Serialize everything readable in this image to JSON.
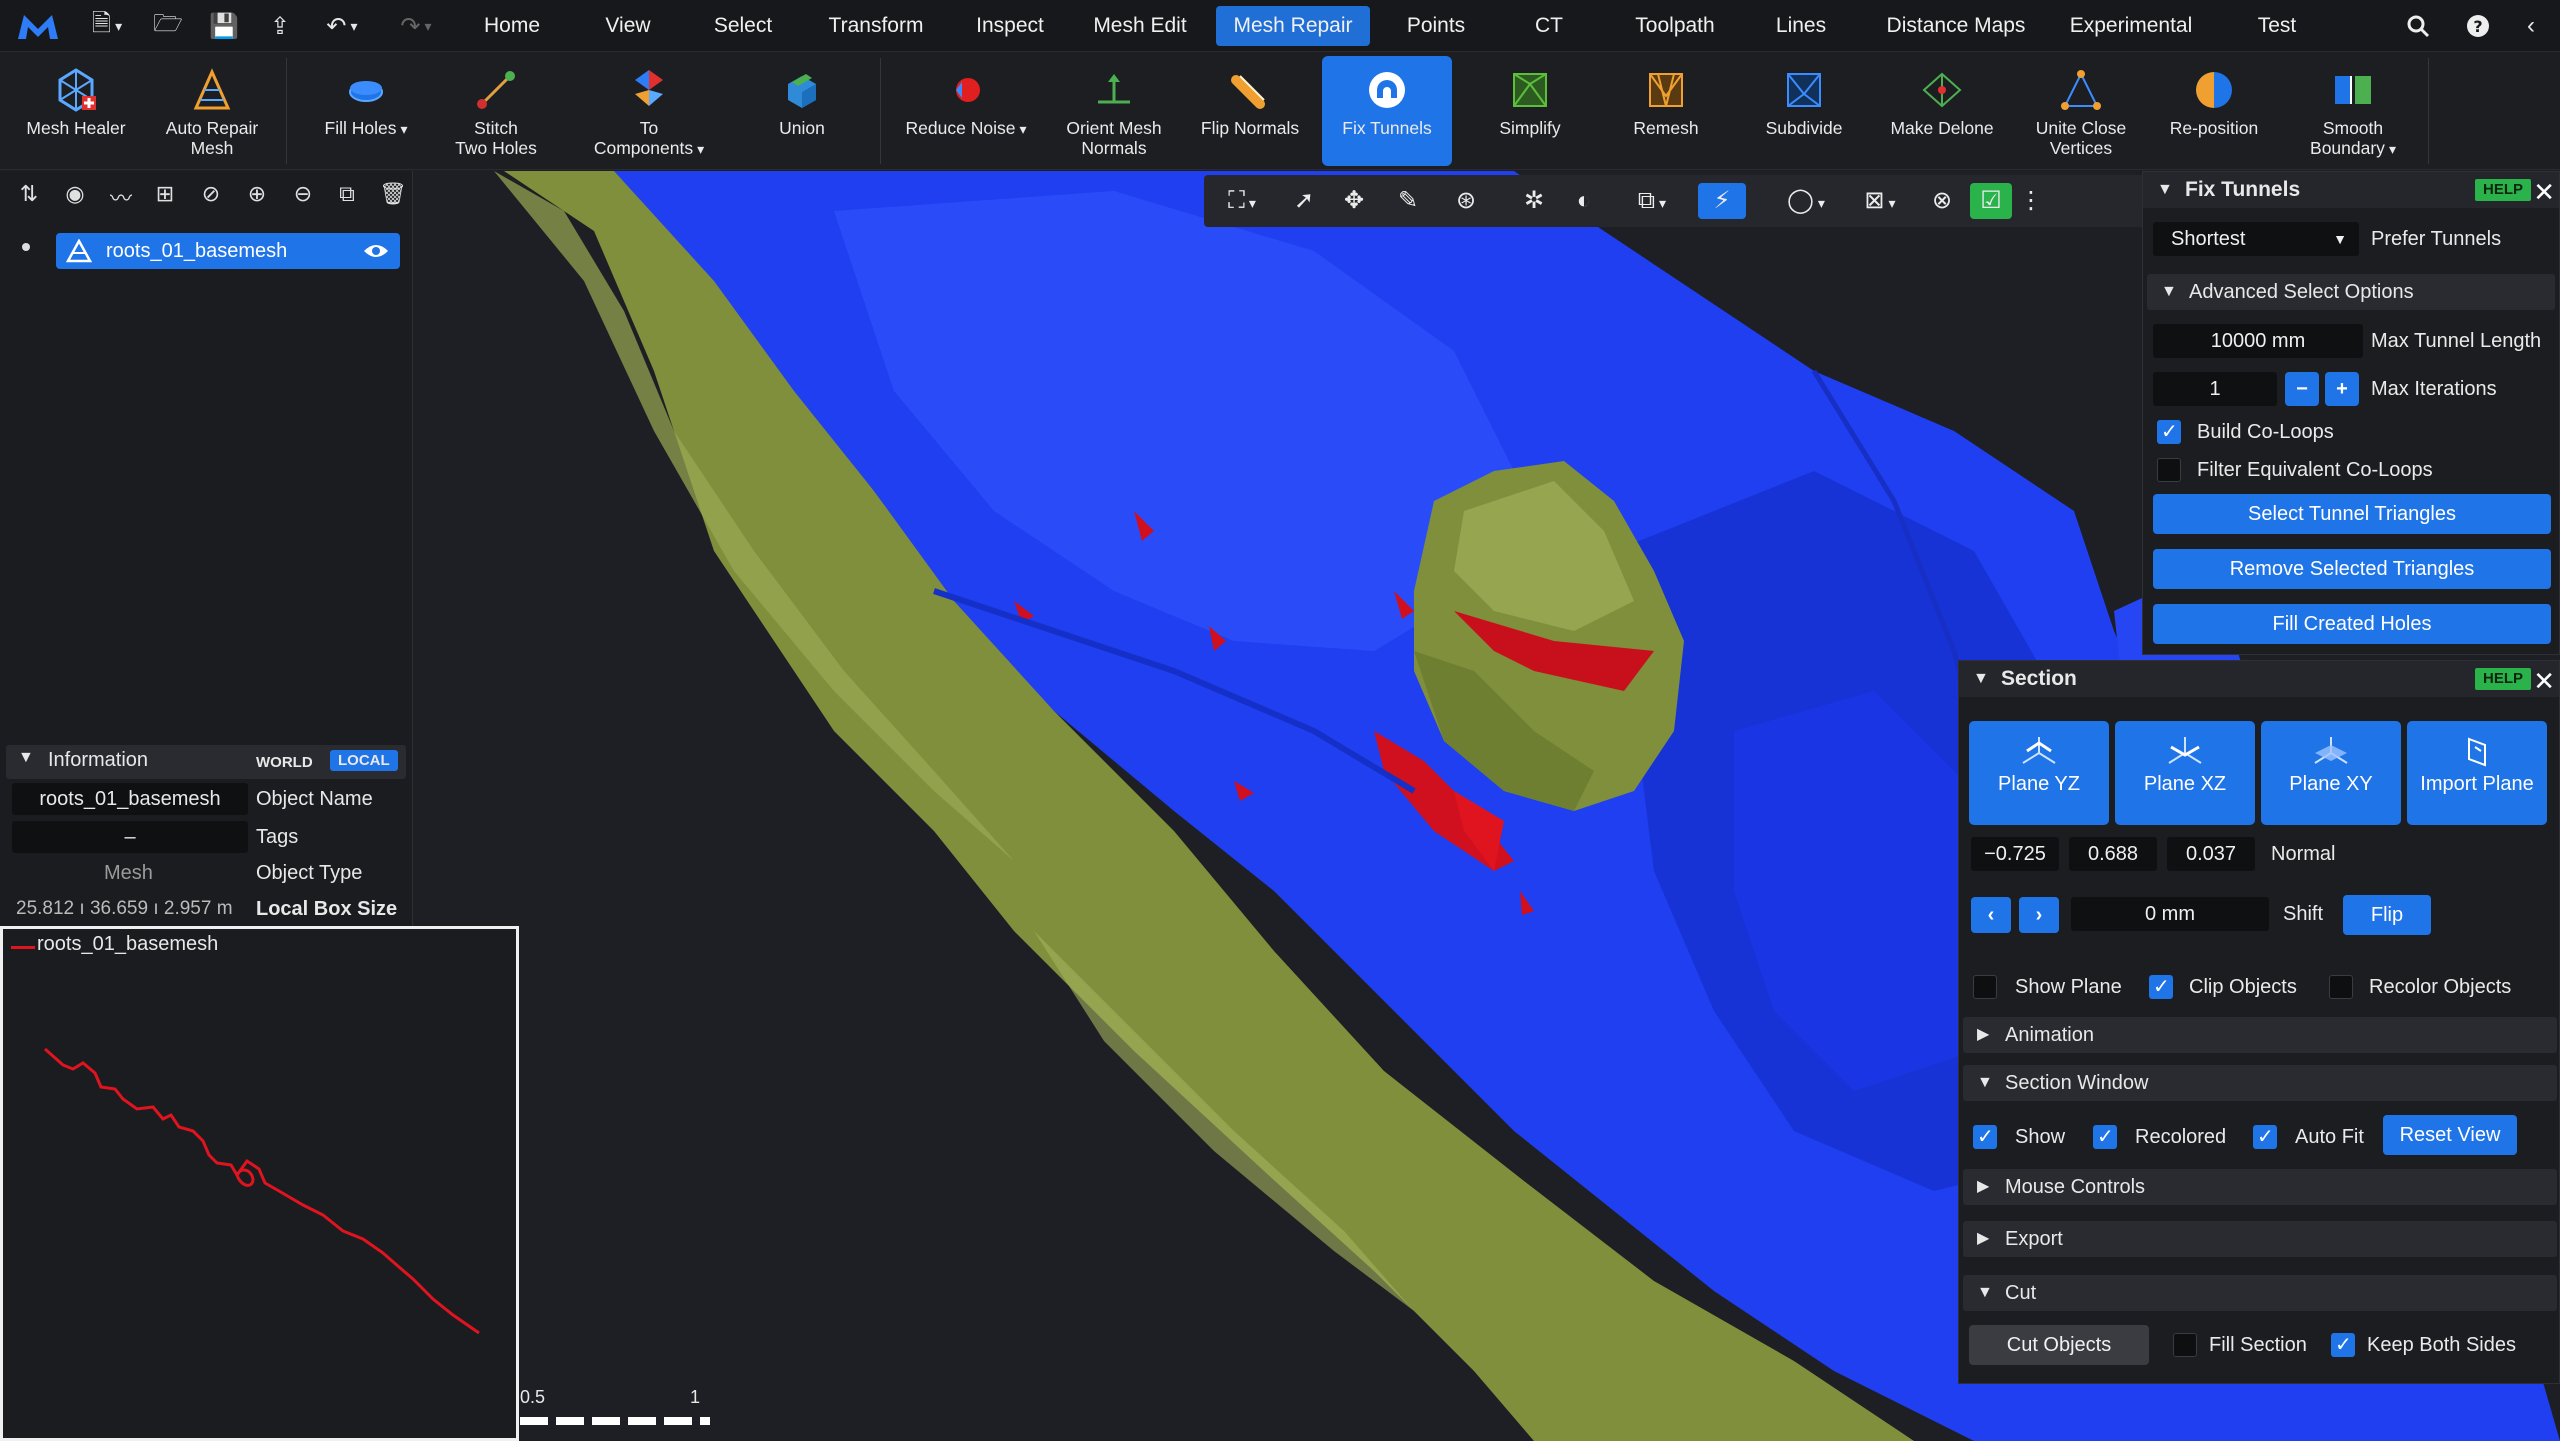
{
  "menubar": {
    "tabs": [
      "Home",
      "View",
      "Select",
      "Transform",
      "Inspect",
      "Mesh Edit",
      "Mesh Repair",
      "Points",
      "CT",
      "Toolpath",
      "Lines",
      "Distance Maps",
      "Experimental",
      "Test"
    ],
    "active_tab": "Mesh Repair"
  },
  "ribbon": {
    "tools": [
      {
        "label": "Mesh Healer",
        "icon": "mesh-healer-icon"
      },
      {
        "label": "Auto Repair\nMesh",
        "icon": "auto-repair-icon"
      },
      {
        "label": "Fill Holes",
        "icon": "fill-holes-icon"
      },
      {
        "label": "Stitch\nTwo Holes",
        "icon": "stitch-icon"
      },
      {
        "label": "To\nComponents",
        "icon": "components-icon"
      },
      {
        "label": "Union",
        "icon": "union-icon"
      },
      {
        "label": "Reduce Noise",
        "icon": "reduce-noise-icon"
      },
      {
        "label": "Orient Mesh\nNormals",
        "icon": "orient-normals-icon"
      },
      {
        "label": "Flip Normals",
        "icon": "flip-normals-icon"
      },
      {
        "label": "Fix Tunnels",
        "icon": "fix-tunnels-icon"
      },
      {
        "label": "Simplify",
        "icon": "simplify-icon"
      },
      {
        "label": "Remesh",
        "icon": "remesh-icon"
      },
      {
        "label": "Subdivide",
        "icon": "subdivide-icon"
      },
      {
        "label": "Make Delone",
        "icon": "delone-icon"
      },
      {
        "label": "Unite Close\nVertices",
        "icon": "unite-vertices-icon"
      },
      {
        "label": "Re-position",
        "icon": "reposition-icon"
      },
      {
        "label": "Smooth\nBoundary",
        "icon": "smooth-boundary-icon"
      }
    ]
  },
  "scene": {
    "object_name": "roots_01_basemesh"
  },
  "information": {
    "title": "Information",
    "world": "WORLD",
    "local": "LOCAL",
    "object_name_value": "roots_01_basemesh",
    "object_name_label": "Object Name",
    "tags_value": "–",
    "tags_label": "Tags",
    "type_value": "Mesh",
    "type_label": "Object Type",
    "box_value": "25.812 ı 36.659 ı 2.957 m",
    "box_label": "Local Box Size"
  },
  "section_window": {
    "legend": "roots_01_basemesh",
    "scale_labels": [
      "0.5",
      "1"
    ]
  },
  "fix_tunnels": {
    "title": "Fix Tunnels",
    "help": "HELP",
    "mode_value": "Shortest",
    "mode_label": "Prefer Tunnels",
    "advanced_title": "Advanced Select Options",
    "max_length_value": "10000 mm",
    "max_length_label": "Max Tunnel Length",
    "iterations_value": "1",
    "iterations_label": "Max Iterations",
    "build_coloops": "Build Co-Loops",
    "filter_coloops": "Filter Equivalent Co-Loops",
    "btn_select": "Select Tunnel Triangles",
    "btn_remove": "Remove Selected Triangles",
    "btn_fill": "Fill Created Holes"
  },
  "section": {
    "title": "Section",
    "help": "HELP",
    "plane_buttons": [
      "Plane YZ",
      "Plane XZ",
      "Plane XY",
      "Import Plane"
    ],
    "normal": [
      "−0.725",
      "0.688",
      "0.037"
    ],
    "normal_label": "Normal",
    "shift_value": "0 mm",
    "shift_label": "Shift",
    "flip": "Flip",
    "show_plane": "Show Plane",
    "clip_objects": "Clip Objects",
    "recolor_objects": "Recolor Objects",
    "animation": "Animation",
    "section_window": "Section Window",
    "show": "Show",
    "recolored": "Recolored",
    "auto_fit": "Auto Fit",
    "reset_view": "Reset View",
    "mouse_controls": "Mouse Controls",
    "export": "Export",
    "cut": "Cut",
    "cut_objects": "Cut Objects",
    "fill_section": "Fill Section",
    "keep_both_sides": "Keep Both Sides"
  },
  "colors": {
    "accent": "#1f74e8",
    "mesh_blue": "#1f3ff0",
    "mesh_olive": "#8a9a4a",
    "highlight_red": "#d0101e",
    "help_green": "#29b34a"
  }
}
